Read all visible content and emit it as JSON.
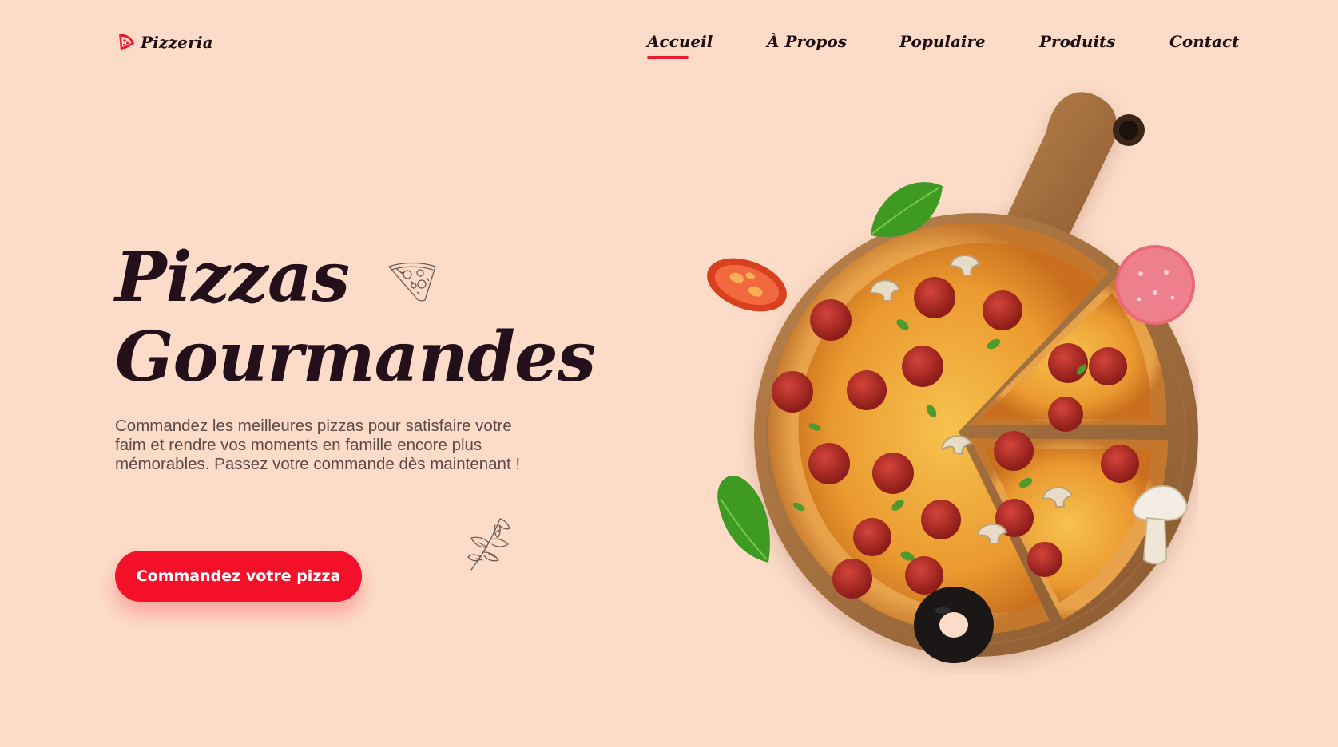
{
  "header": {
    "logo_text": "Pizzeria",
    "logo_icon": "pizza-slice-icon",
    "nav": [
      {
        "label": "Accueil",
        "active": true
      },
      {
        "label": "À Propos",
        "active": false
      },
      {
        "label": "Populaire",
        "active": false
      },
      {
        "label": "Produits",
        "active": false
      },
      {
        "label": "Contact",
        "active": false
      }
    ]
  },
  "hero": {
    "title_line1": "Pizzas",
    "title_line2": "Gourmandes",
    "description": "Commandez les meilleures pizzas pour satisfaire votre faim et rendre vos moments en famille encore plus mémorables. Passez votre commande dès maintenant !",
    "cta_label": "Commandez votre pizza"
  },
  "decorations": {
    "sketch_slice": "pizza-slice-sketch-icon",
    "sketch_herb": "basil-sprig-sketch-icon"
  },
  "illustration": "pizza-on-wooden-board",
  "colors": {
    "background": "#fcdcc8",
    "accent": "#f5102a",
    "heading": "#24101a",
    "body_text": "#5c4a46"
  }
}
